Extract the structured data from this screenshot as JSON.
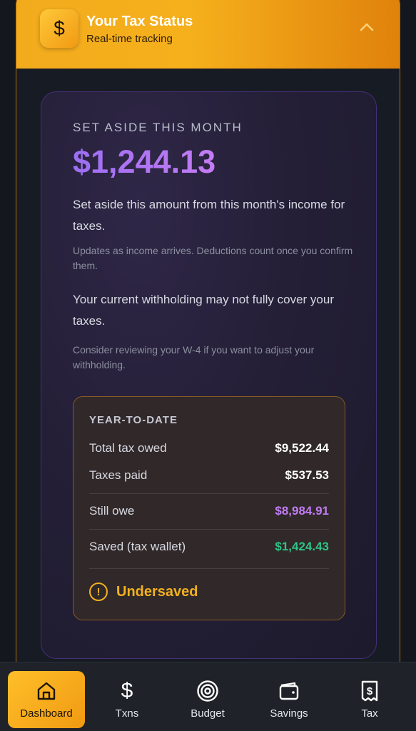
{
  "header": {
    "title": "Your Tax Status",
    "subtitle": "Real-time tracking",
    "icon": "dollar-icon",
    "toggle_icon": "chevron-up-icon"
  },
  "status_card": {
    "set_aside_label": "SET ASIDE THIS MONTH",
    "amount": "$1,244.13",
    "description": "Set aside this amount from this month's income for taxes.",
    "note": "Updates as income arrives. Deductions count once you confirm them.",
    "warning": "Your current withholding may not fully cover your taxes.",
    "suggestion": "Consider reviewing your W-4 if you want to adjust your withholding."
  },
  "ytd": {
    "title": "YEAR-TO-DATE",
    "rows": [
      {
        "label": "Total tax owed",
        "value": "$9,522.44",
        "color": "#ffffff"
      },
      {
        "label": "Taxes paid",
        "value": "$537.53",
        "color": "#ffffff"
      },
      {
        "label": "Still owe",
        "value": "$8,984.91",
        "color": "#c07cf3"
      },
      {
        "label": "Saved (tax wallet)",
        "value": "$1,424.43",
        "color": "#2fc486"
      }
    ],
    "status": "Undersaved",
    "status_icon": "alert-circle-icon"
  },
  "nav": {
    "items": [
      {
        "label": "Dashboard",
        "icon": "home-icon",
        "active": true
      },
      {
        "label": "Txns",
        "icon": "dollar-icon",
        "active": false
      },
      {
        "label": "Budget",
        "icon": "target-icon",
        "active": false
      },
      {
        "label": "Savings",
        "icon": "wallet-icon",
        "active": false
      },
      {
        "label": "Tax",
        "icon": "receipt-icon",
        "active": false
      }
    ]
  },
  "colors": {
    "accent": "#f2ab1d",
    "purple": "#a670f3",
    "green": "#2fc486",
    "background": "#14171e"
  }
}
